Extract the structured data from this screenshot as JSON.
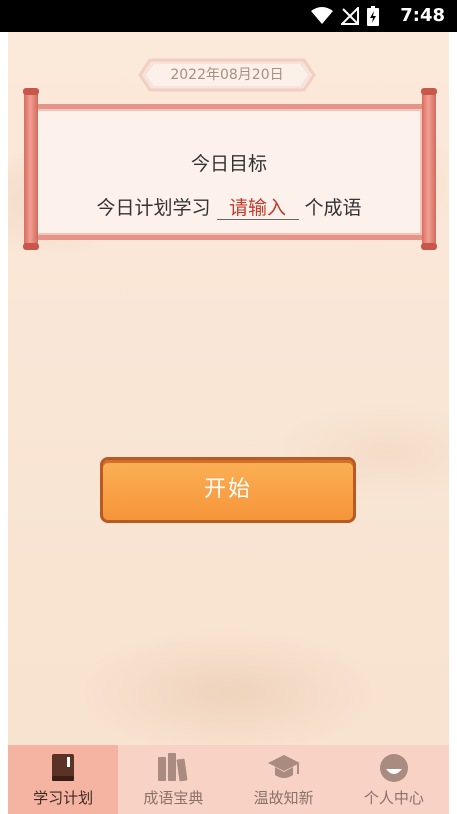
{
  "status_bar": {
    "time": "7:48"
  },
  "date": "2022年08月20日",
  "goal": {
    "title": "今日目标",
    "prefix": "今日计划学习",
    "input_placeholder": "请输入",
    "suffix": "个成语"
  },
  "start_button": "开始",
  "tabs": [
    {
      "label": "学习计划",
      "icon": "book-icon",
      "active": true
    },
    {
      "label": "成语宝典",
      "icon": "books-icon",
      "active": false
    },
    {
      "label": "温故知新",
      "icon": "graduation-cap-icon",
      "active": false
    },
    {
      "label": "个人中心",
      "icon": "user-icon",
      "active": false
    }
  ],
  "colors": {
    "accent": "#f6953a",
    "input_text": "#c23b2d",
    "tab_active": "#f5b4a2"
  }
}
